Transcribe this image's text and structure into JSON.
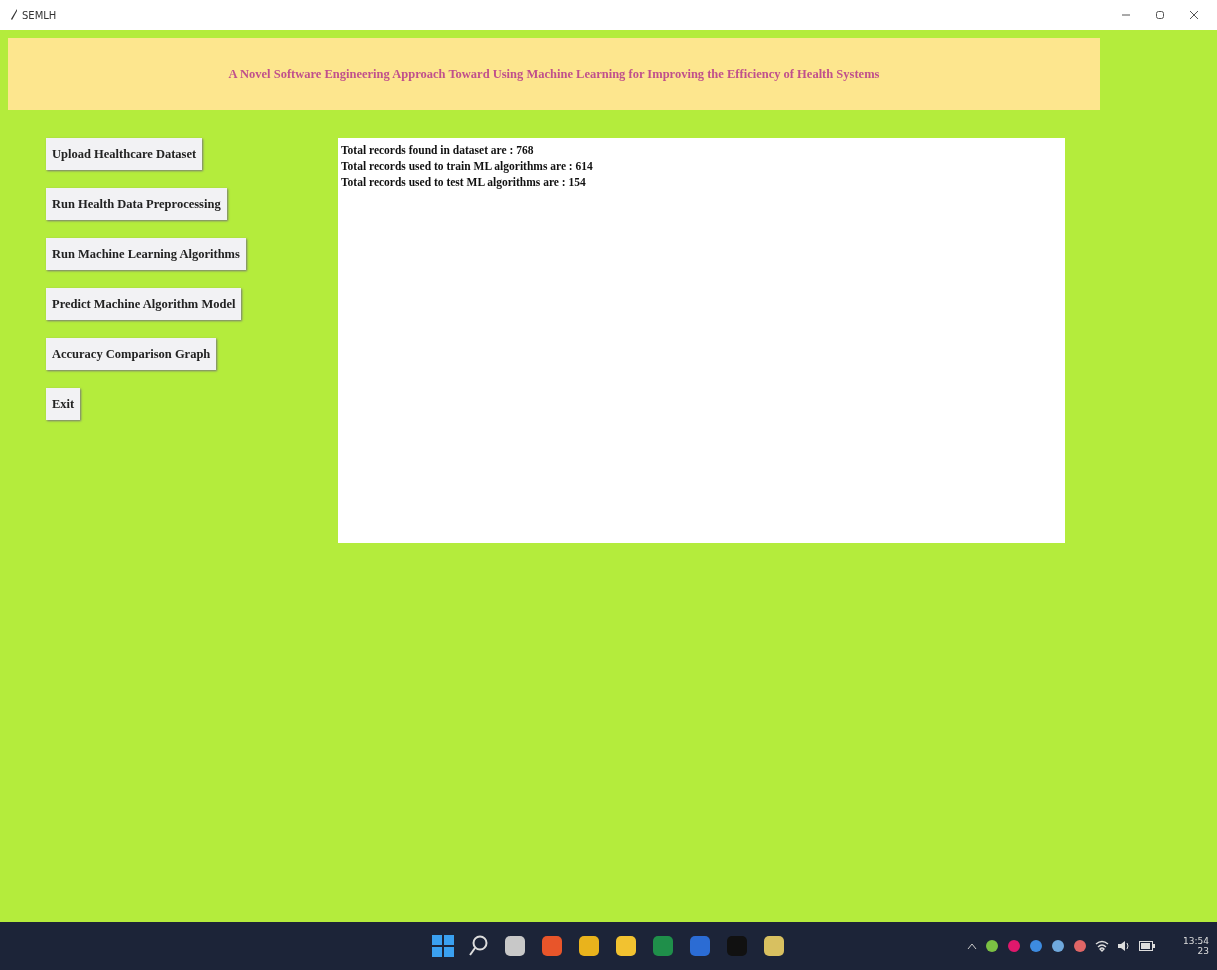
{
  "window": {
    "title": "SEMLH"
  },
  "header": {
    "title": "A Novel Software Engineering Approach Toward Using Machine Learning for Improving the Efficiency of Health Systems"
  },
  "buttons": [
    {
      "label": "Upload Healthcare Dataset"
    },
    {
      "label": "Run Health Data Preprocessing"
    },
    {
      "label": "Run Machine Learning Algorithms"
    },
    {
      "label": "Predict Machine Algorithm Model"
    },
    {
      "label": "Accuracy Comparison Graph"
    },
    {
      "label": "Exit"
    }
  ],
  "output": {
    "lines": [
      "Total records found in dataset are : 768",
      "Total records used to train ML algorithms are : 614",
      "Total records used to test ML algorithms are : 154"
    ]
  },
  "taskbar": {
    "apps": [
      {
        "kind": "start"
      },
      {
        "kind": "search"
      },
      {
        "kind": "app",
        "color": "#c8c8c8"
      },
      {
        "kind": "app",
        "color": "#e8552a"
      },
      {
        "kind": "app",
        "color": "#e9b31c"
      },
      {
        "kind": "app",
        "color": "#f2c230"
      },
      {
        "kind": "app",
        "color": "#1f8f4a"
      },
      {
        "kind": "app",
        "color": "#2b6cd4"
      },
      {
        "kind": "app",
        "color": "#111111"
      },
      {
        "kind": "app",
        "color": "#d8c060"
      }
    ],
    "tray": [
      {
        "color": "#7bc043"
      },
      {
        "color": "#e0186c"
      },
      {
        "color": "#3d8be0"
      },
      {
        "color": "#6fa8dc"
      },
      {
        "color": "#e06666"
      }
    ],
    "time": "13:54",
    "date": "23"
  }
}
